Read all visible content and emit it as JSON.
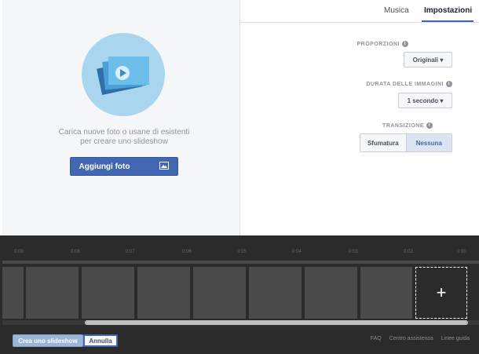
{
  "colors": {
    "accent": "#4267b2",
    "illustration_circle": "#a9d5ee",
    "timeline_bg": "#2b2b2b",
    "frame": "#4a4a4a"
  },
  "tabs": [
    {
      "label": "Impostazioni",
      "active": true
    },
    {
      "label": "Musica",
      "active": false
    }
  ],
  "upload": {
    "line1": "Carica nuove foto o usane di esistenti",
    "line2": "per creare uno slideshow",
    "add_button": "Aggiungi foto",
    "add_icon": "photo-icon"
  },
  "settings": {
    "aspect": {
      "label": "PROPORZIONI",
      "value": "Originali ▾"
    },
    "duration": {
      "label": "DURATA DELLE IMMAGINI",
      "value": "1 secondo ▾"
    },
    "transition": {
      "label": "TRANSIZIONE",
      "options": [
        "Nessuna",
        "Sfumatura"
      ],
      "selected": "Nessuna"
    }
  },
  "timeline": {
    "ticks": [
      "0:00",
      "0:01",
      "0:02",
      "0:03",
      "0:04",
      "0:05",
      "0:06",
      "0:07",
      "0:08",
      "0:09"
    ],
    "add_label": "+"
  },
  "footer": {
    "cancel_label": "Annulla",
    "create_label": "Crea uno slideshow",
    "links": [
      "Linee guida",
      "Centro assistenza",
      "FAQ"
    ]
  }
}
